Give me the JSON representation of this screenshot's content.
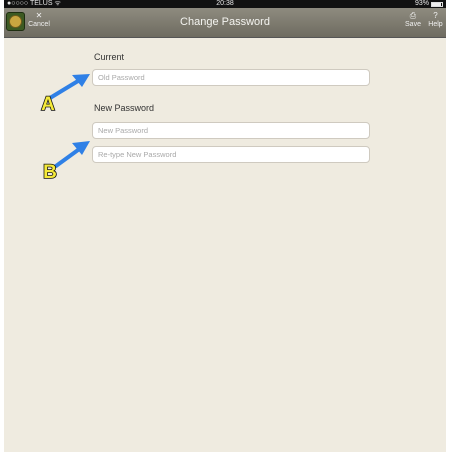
{
  "status_bar": {
    "carrier": "●○○○○ TELUS ᯤ",
    "time": "20:38",
    "battery": "93%",
    "battery_level": 0.93
  },
  "nav_bar": {
    "title": "Change Password",
    "cancel_label": "Cancel",
    "cancel_icon": "close-icon",
    "save_label": "Save",
    "save_icon": "save-icon",
    "help_label": "Help",
    "help_icon": "question-icon"
  },
  "form": {
    "current_label": "Current",
    "current_placeholder": "Old Password",
    "new_label": "New Password",
    "new_placeholder": "New Password",
    "retype_placeholder": "Re-type New Password"
  },
  "annotations": [
    {
      "letter": "A"
    },
    {
      "letter": "B"
    }
  ],
  "colors": {
    "arrow": "#2f80e6",
    "letter_fill": "#f5ea3a",
    "background": "#efebe0",
    "navbar": "#7e7b70"
  }
}
